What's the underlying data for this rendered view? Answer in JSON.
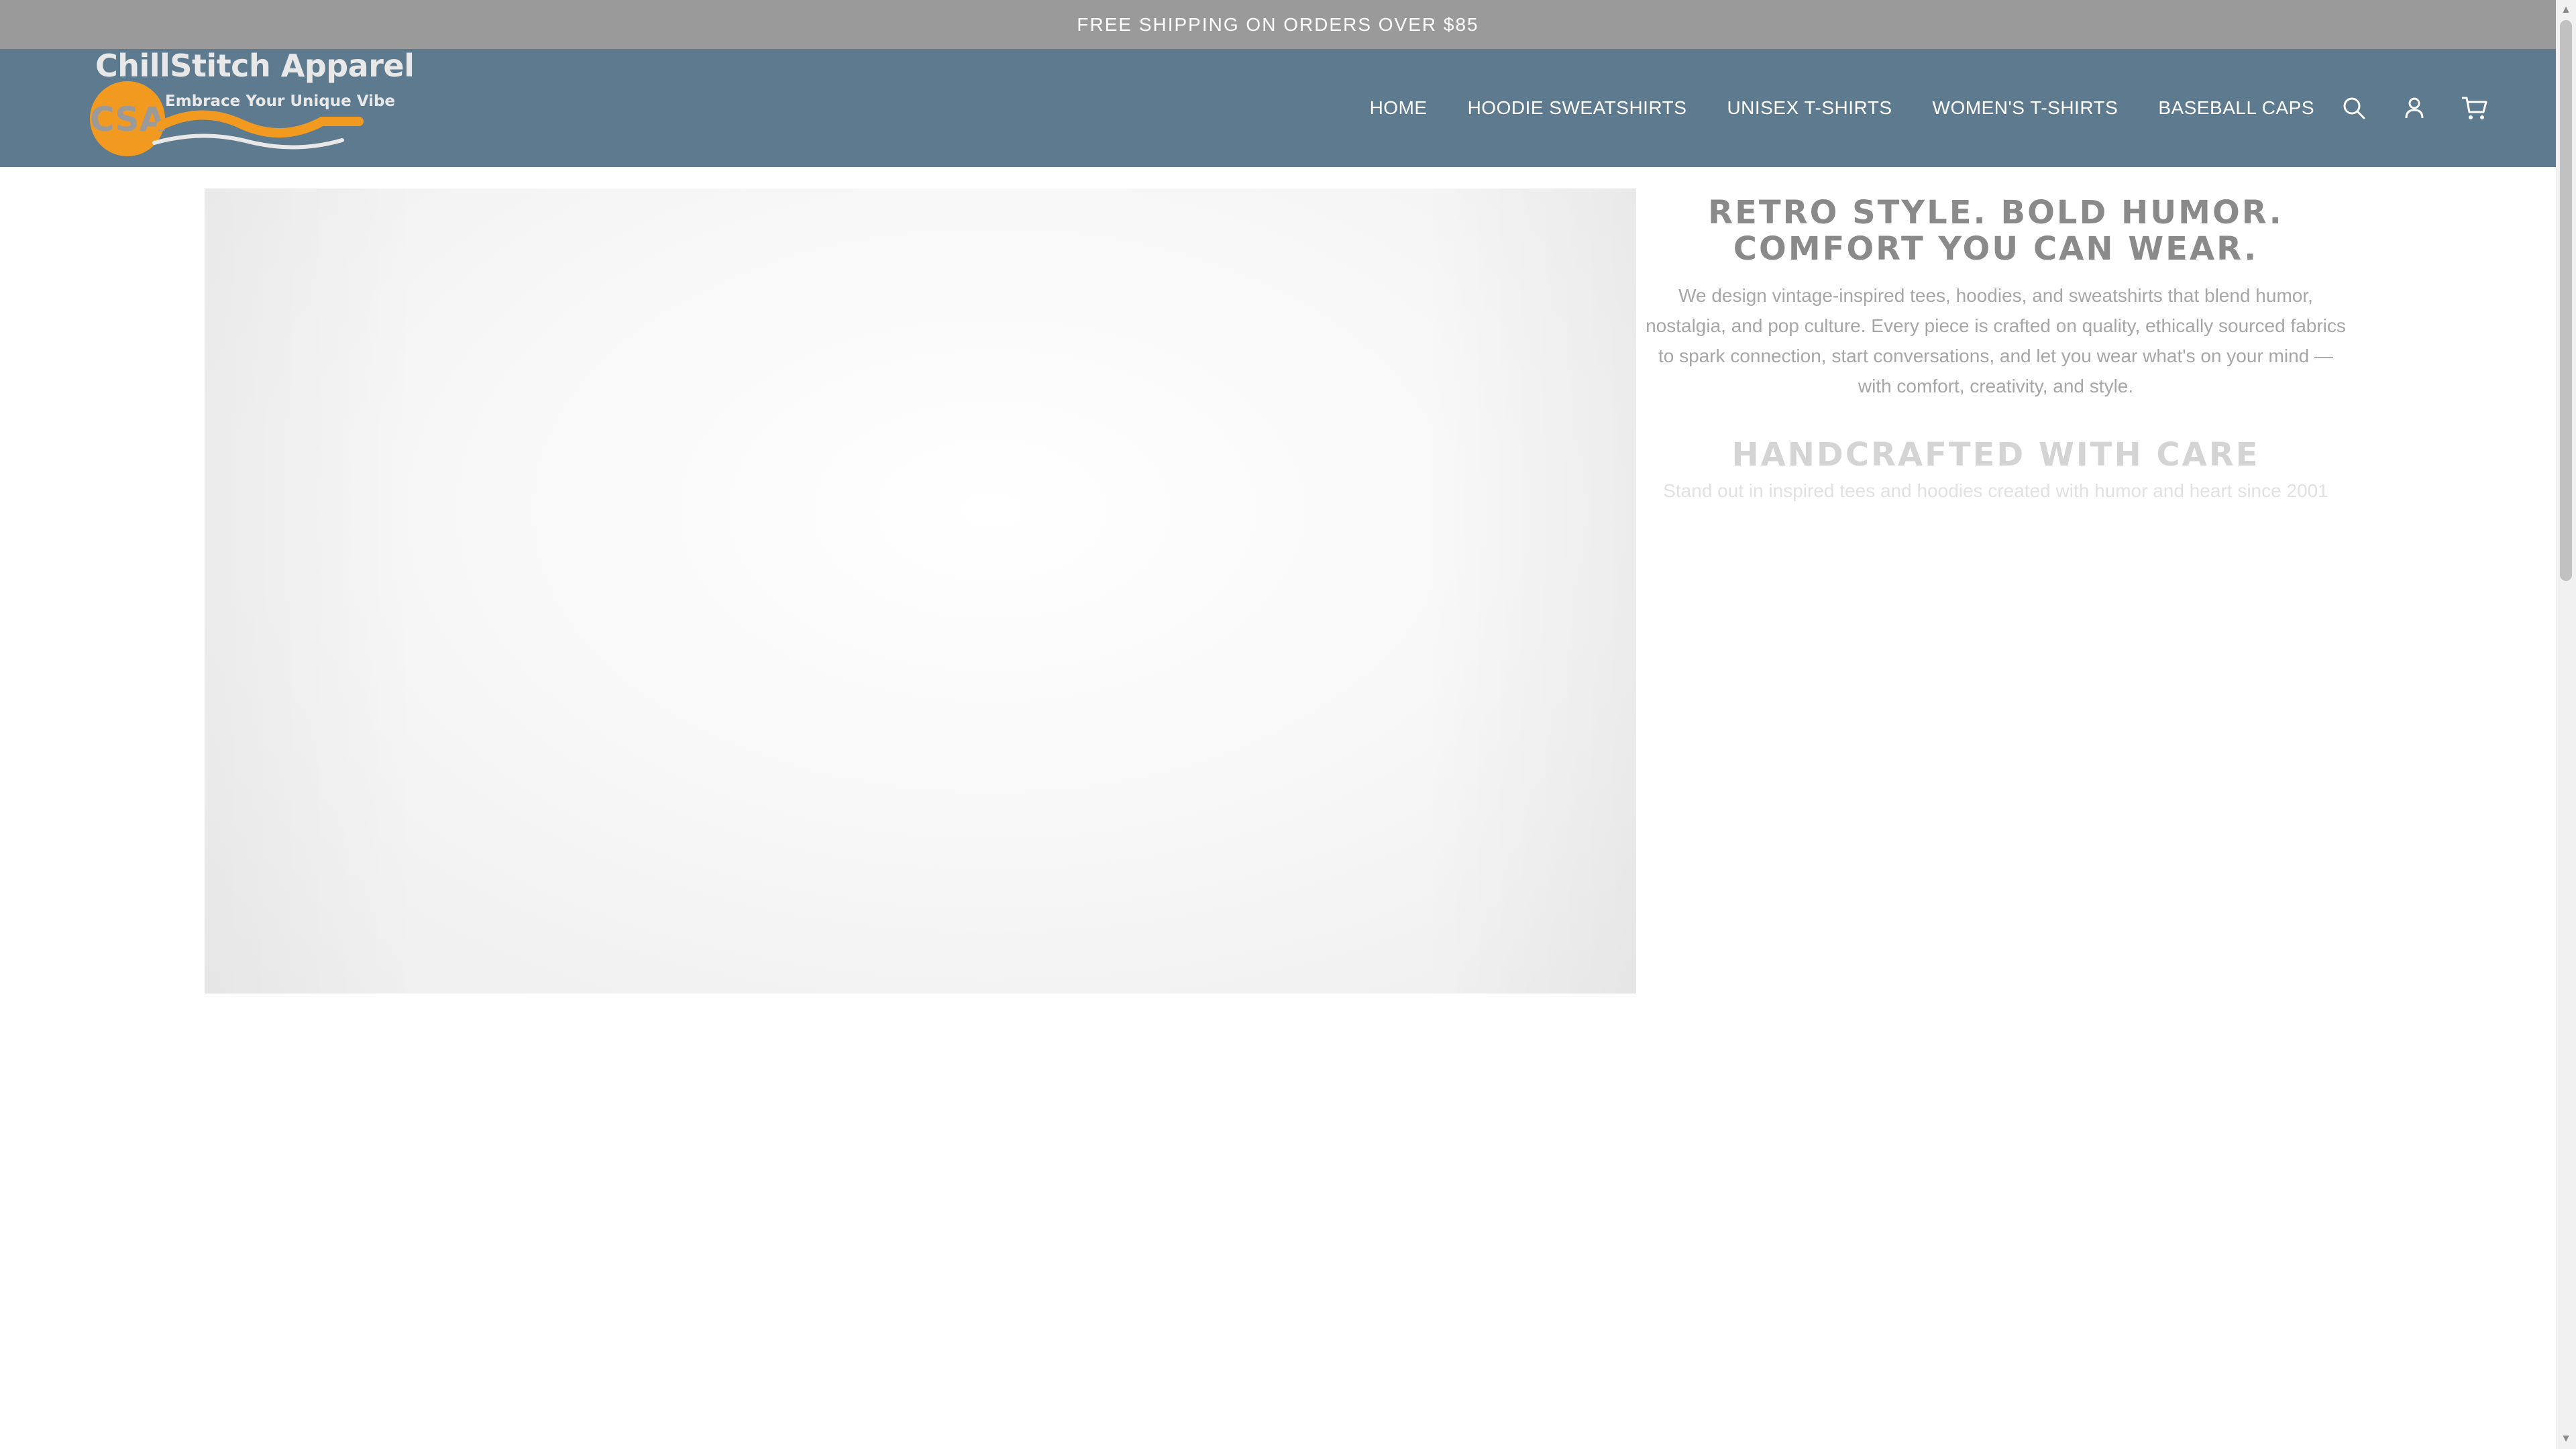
{
  "announcement": {
    "text": "FREE SHIPPING ON ORDERS OVER $85"
  },
  "brand": {
    "name": "ChillStitch Apparel",
    "tagline": "Embrace Your Unique Vibe",
    "monogram": "CSA",
    "colors": {
      "orange": "#f29a1f",
      "header": "#5d7a8e"
    }
  },
  "nav": {
    "items": [
      {
        "label": "HOME"
      },
      {
        "label": "HOODIE SWEATSHIRTS"
      },
      {
        "label": "UNISEX T-SHIRTS"
      },
      {
        "label": "WOMEN'S T-SHIRTS"
      },
      {
        "label": "BASEBALL CAPS"
      }
    ]
  },
  "header_icons": [
    "search-icon",
    "account-icon",
    "cart-icon"
  ],
  "hero": {
    "headline": "RETRO STYLE. BOLD HUMOR. COMFORT YOU CAN WEAR.",
    "body": "We design vintage-inspired tees, hoodies, and sweatshirts that blend humor, nostalgia, and pop culture. Every piece is crafted on quality, ethically sourced fabrics to spark connection, start conversations, and let you wear what's on your mind — with comfort, creativity, and style.",
    "subheading": "HANDCRAFTED WITH CARE",
    "tagline": "Stand out in inspired tees and hoodies created with humor and heart since 2001"
  },
  "scrollbar": {
    "up": "▲",
    "down": "▼"
  }
}
